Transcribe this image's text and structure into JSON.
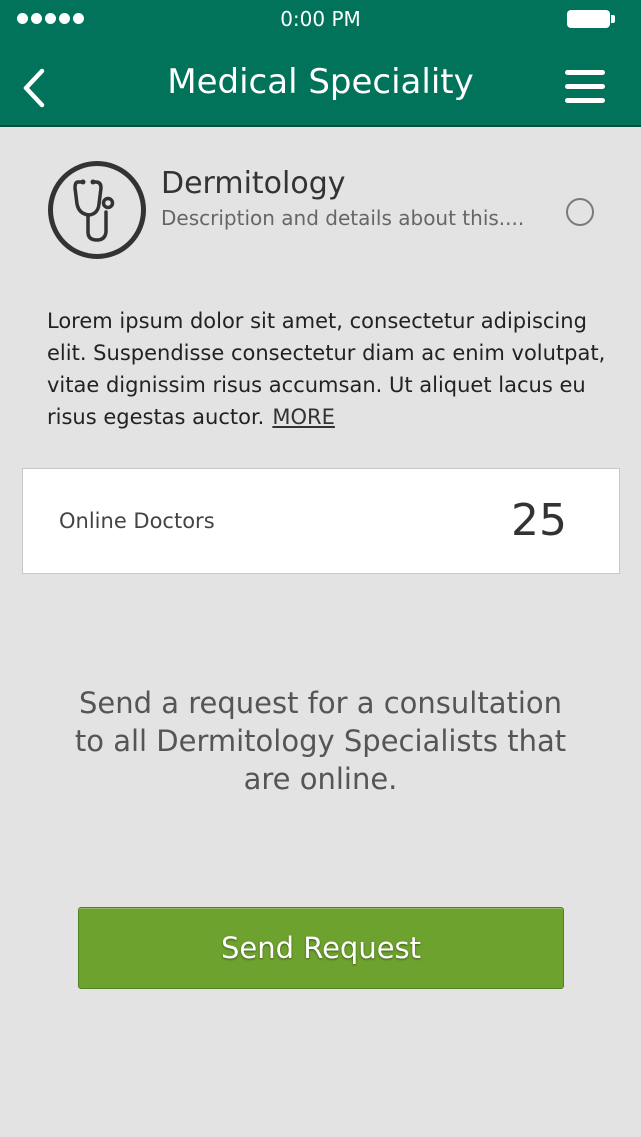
{
  "status_bar": {
    "time": "0:00 PM"
  },
  "header": {
    "title": "Medical Speciality"
  },
  "speciality": {
    "name": "Dermitology",
    "description": "Description and details about this....",
    "icon": "stethoscope-icon",
    "selected": false
  },
  "body": {
    "text": "Lorem ipsum dolor sit amet, consectetur adipiscing elit. Suspendisse consectetur diam ac enim volutpat, vitae dignissim risus accumsan. Ut aliquet lacus eu risus egestas auctor.",
    "more_label": "MORE"
  },
  "online_doctors": {
    "label": "Online Doctors",
    "count": "25"
  },
  "request_note": "Send a request for a consultation to all Dermitology Specialists that are online.",
  "send_button": {
    "label": "Send Request"
  },
  "colors": {
    "header": "#00735a",
    "background": "#e3e3e3",
    "button": "#6ea22e"
  }
}
